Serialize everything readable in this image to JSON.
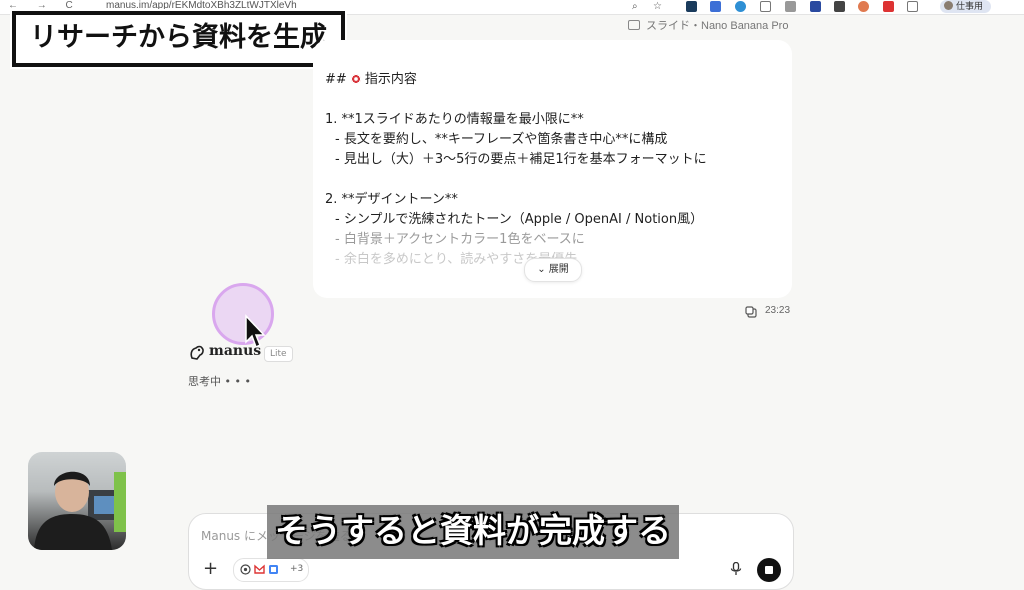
{
  "browser": {
    "nav_glyphs": "← → C",
    "url": "manus.im/app/rEKMdtoXBh3ZLtWJTXleVh",
    "profile_label": "仕事用"
  },
  "overlay": {
    "title": "リサーチから資料を生成",
    "subtitle": "そうすると資料が完成する"
  },
  "task": {
    "label": "スライド・Nano Banana Pro"
  },
  "message": {
    "lines": [
      "## 指示内容",
      "1. **1スライドあたりの情報量を最小限に**",
      "   - 長文を要約し、**キーフレーズや箇条書き中心**に構成",
      "   - 見出し（大）＋3〜5行の要点＋補足1行を基本フォーマットに",
      "2. **デザイントーン**",
      "   - シンプルで洗練されたトーン（Apple / OpenAI / Notion風）",
      "   - 白背景＋アクセントカラー1色をベースに",
      "   - 余白を多めにとり、読みやすさを最優先"
    ],
    "expand_label": "⌄ 展開",
    "timestamp": "23:23"
  },
  "agent": {
    "name": "manus",
    "badge": "Lite",
    "status": "思考中 • • •"
  },
  "composer": {
    "placeholder": "Manus にメッセージを送る",
    "add_glyph": "+",
    "tools_extra": "+3"
  },
  "colors": {
    "accent_highlight": "#d9a7ee",
    "stop_button": "#111111",
    "card_bg": "#ffffff",
    "page_bg": "#f7f7f5"
  }
}
